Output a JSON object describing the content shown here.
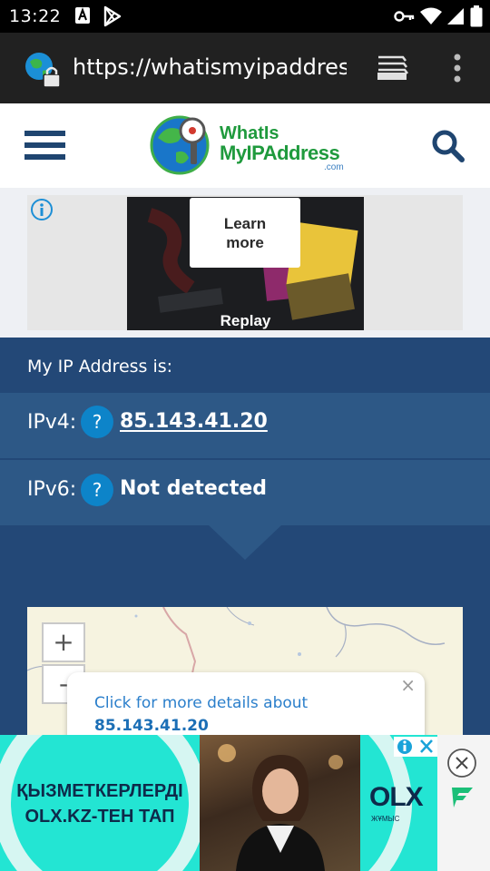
{
  "status_bar": {
    "time": "13:22"
  },
  "browser": {
    "url": "https://whatismyipaddress.com"
  },
  "site": {
    "logo_line1": "WhatIs",
    "logo_line2": "MyIPAddress",
    "logo_domain": ".com"
  },
  "ad": {
    "learn_more": "Learn\nmore",
    "replay": "Replay"
  },
  "ip_panel": {
    "heading": "My IP Address is:",
    "ipv4_label": "IPv4:",
    "ipv4_value": "85.143.41.20",
    "ipv6_label": "IPv6:",
    "ipv6_value": "Not detected",
    "help_glyph": "?"
  },
  "map": {
    "zoom_in": "+",
    "zoom_out": "-",
    "popup_text": "Click for more details about",
    "popup_ip": "85.143.41.20",
    "popup_close": "×"
  },
  "bottom_ad": {
    "line1": "ҚЫЗМЕТКЕРЛЕРДІ",
    "line2": "OLX.KZ-ТЕН ТАП",
    "brand": "OLX",
    "brand_sub": "ЖҰМЫС"
  },
  "colors": {
    "panel_blue": "#234877",
    "row_blue": "#2d5886",
    "accent": "#0d84c9",
    "brand_green": "#1f9a3d",
    "ad_teal": "#23e5d3"
  }
}
